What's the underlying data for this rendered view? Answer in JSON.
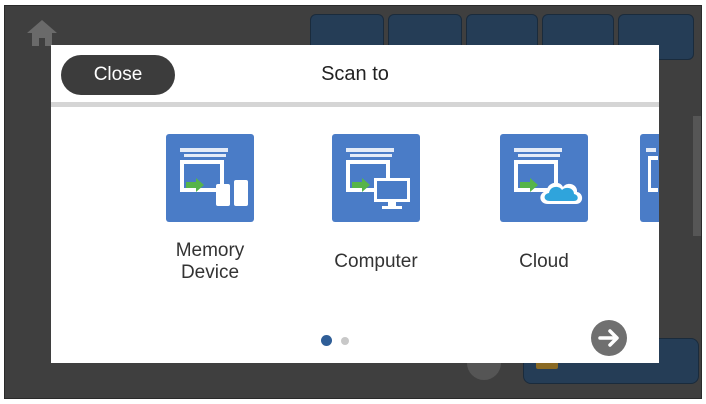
{
  "dialog": {
    "title": "Scan to",
    "close_label": "Close"
  },
  "destinations": [
    {
      "label_line1": "Memory",
      "label_line2": "Device",
      "icon": "memory-device-icon"
    },
    {
      "label": "Computer",
      "icon": "computer-icon"
    },
    {
      "label": "Cloud",
      "icon": "cloud-icon"
    }
  ],
  "pager": {
    "pages": 2,
    "current": 1
  },
  "colors": {
    "tile_blue": "#4a7cc7",
    "close_button": "#3c3c3c",
    "active_dot": "#2f5e97",
    "next_button": "#707070",
    "status_bar_blue": "#253d56"
  }
}
